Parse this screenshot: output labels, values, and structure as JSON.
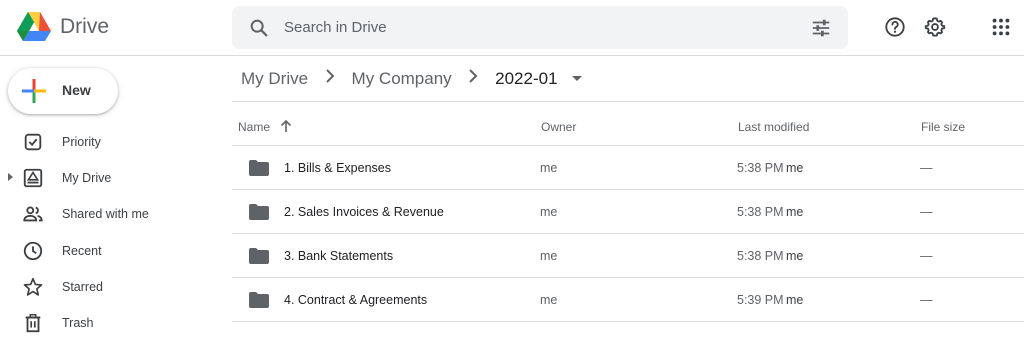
{
  "app": {
    "name": "Drive"
  },
  "search": {
    "placeholder": "Search in Drive"
  },
  "new_button": {
    "label": "New"
  },
  "sidebar": {
    "items": [
      {
        "label": "Priority",
        "icon": "priority-icon"
      },
      {
        "label": "My Drive",
        "icon": "my-drive-icon",
        "expandable": true
      },
      {
        "label": "Shared with me",
        "icon": "shared-icon"
      },
      {
        "label": "Recent",
        "icon": "clock-icon"
      },
      {
        "label": "Starred",
        "icon": "star-icon"
      },
      {
        "label": "Trash",
        "icon": "trash-icon"
      }
    ]
  },
  "breadcrumb": {
    "items": [
      "My Drive",
      "My Company"
    ],
    "current": "2022-01"
  },
  "table": {
    "headers": {
      "name": "Name",
      "owner": "Owner",
      "modified": "Last modified",
      "size": "File size"
    },
    "sort": {
      "column": "name",
      "direction": "ascending"
    },
    "rows": [
      {
        "name": "1. Bills & Expenses",
        "owner": "me",
        "time": "5:38 PM",
        "modified_by": "me",
        "size": "—"
      },
      {
        "name": "2. Sales Invoices & Revenue",
        "owner": "me",
        "time": "5:38 PM",
        "modified_by": "me",
        "size": "—"
      },
      {
        "name": "3. Bank Statements",
        "owner": "me",
        "time": "5:38 PM",
        "modified_by": "me",
        "size": "—"
      },
      {
        "name": "4. Contract & Agreements",
        "owner": "me",
        "time": "5:39 PM",
        "modified_by": "me",
        "size": "—"
      }
    ]
  },
  "colors": {
    "icon": "#5f6368",
    "divider": "#dadce0",
    "search_bg": "#f1f3f4",
    "folder": "#5f6368"
  }
}
